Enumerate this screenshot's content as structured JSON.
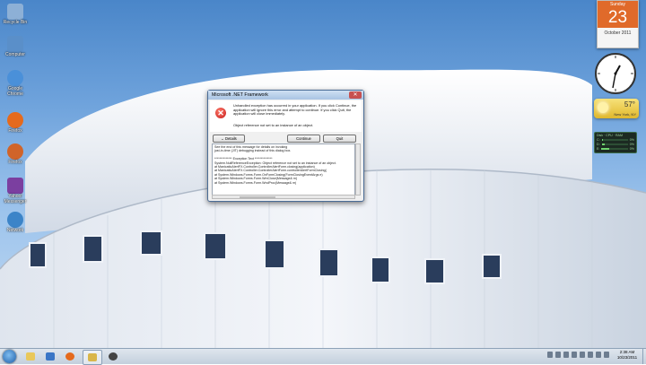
{
  "desktop_icons": [
    {
      "label": "Recycle Bin",
      "color": "#8db0d6"
    },
    {
      "label": "Computer",
      "color": "#5a8fc9"
    },
    {
      "label": "Google Chrome",
      "color": "#4a90d9"
    },
    {
      "label": "Firefox",
      "color": "#e56a1d"
    },
    {
      "label": "Yahoo! Messenger",
      "color": "#7b3fa0"
    },
    {
      "label": "Network",
      "color": "#3c84c8"
    },
    {
      "label": "Command Prompt",
      "color": "#333333"
    }
  ],
  "gadgets": {
    "calendar": {
      "weekday": "Sunday",
      "day": "23",
      "month_year": "October 2011"
    },
    "weather": {
      "temp": "57°",
      "location": "New York, NY"
    },
    "meter": {
      "title": "Disk · CPU · RAM",
      "rows": [
        {
          "label": "C:",
          "pct": "0%",
          "value": 0.0
        },
        {
          "label": "D:",
          "pct": "0%",
          "value": 0.1
        },
        {
          "label": "E:",
          "pct": "0%",
          "value": 0.3
        },
        {
          "label": "S:",
          "pct": "13%",
          "value": 0.13
        }
      ]
    }
  },
  "dialog": {
    "title": "Microsoft .NET Framework",
    "message": "Unhandled exception has occurred in your application. If you click Continue, the application will ignore this error and attempt to continue. If you click Quit, the application will close immediately.",
    "detail_message": "Object reference not set to an instance of an object.",
    "buttons": {
      "details": "Details",
      "continue": "Continue",
      "quit": "Quit"
    },
    "details_lines": [
      "See the end of this message for details on invoking",
      "just-in-time (JIT) debugging instead of this dialog box.",
      "",
      "************** Exception Text **************",
      "System.NullReferenceException: Object reference not set to an instance of an object.",
      "   at ManicatioAlertFX.Controller.ControllerAlertForm.closing(application)",
      "   at ManicatioAlertFX.Controller.ControllerAlertForm.controllerAlertFormClosing(",
      "   at System.Windows.Forms.Form.OnFormClosing(FormClosingEventArgs e)",
      "   at System.Windows.Forms.Form.WmClose(Message& m)",
      "   at System.Windows.Forms.Form.WndProc(Message& m)"
    ]
  },
  "taskbar": {
    "pinned": [
      {
        "name": "explorer-pinned",
        "color": "#e9c85a"
      },
      {
        "name": "media-player-pinned",
        "color": "#3a76c6"
      },
      {
        "name": "firefox-pinned",
        "color": "#e56a1d"
      },
      {
        "name": "folder-pinned",
        "color": "#d9b64a"
      },
      {
        "name": "app-pinned",
        "color": "#444444"
      }
    ],
    "time": "2:38 AM",
    "date": "10/23/2011"
  }
}
